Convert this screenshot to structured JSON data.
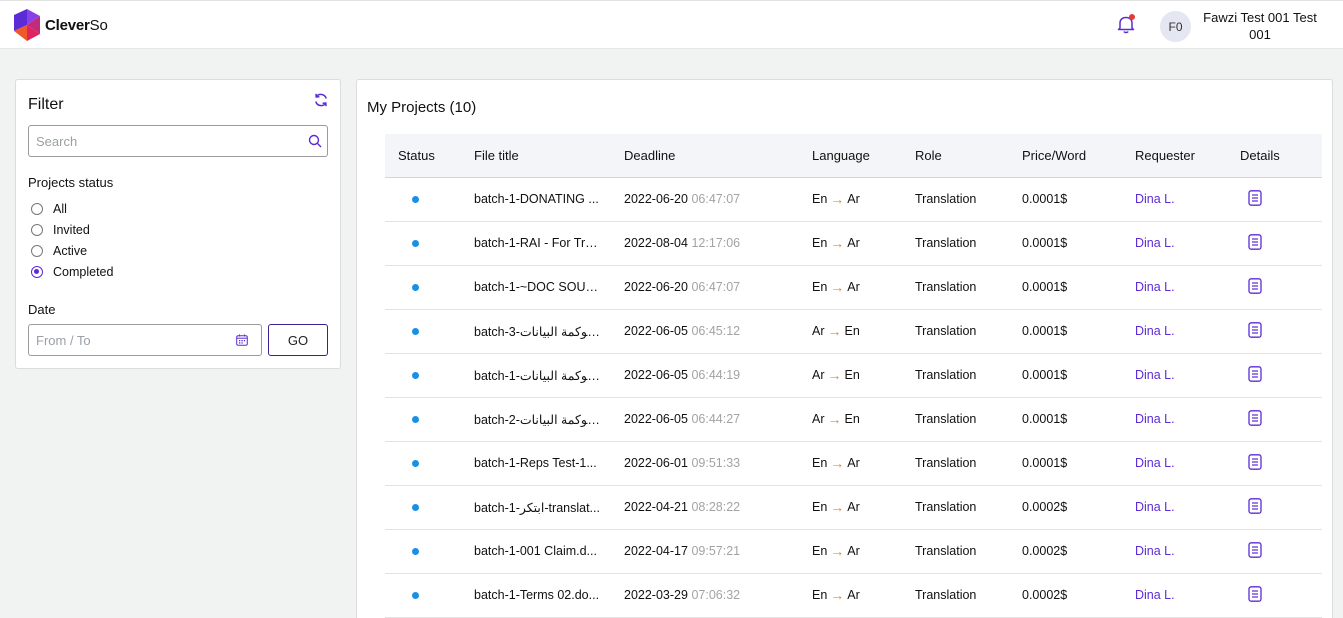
{
  "app": {
    "brand_bold": "Clever",
    "brand_rest": "So",
    "avatar_initials": "F0",
    "user_name": "Fawzi Test 001 Test 001",
    "logo_icon": "cleverso-logo-icon",
    "notification_icon": "bell-icon"
  },
  "colors": {
    "accent": "#5b2bd6",
    "status_dot": "#1a8fe3",
    "arrow": "#f08a24",
    "notification_dot": "#e53935"
  },
  "filter": {
    "title": "Filter",
    "search_placeholder": "Search",
    "status_label": "Projects status",
    "options": [
      "All",
      "Invited",
      "Active",
      "Completed"
    ],
    "selected": "Completed",
    "date_label": "Date",
    "date_placeholder": "From / To",
    "go_label": "GO"
  },
  "projects": {
    "title": "My Projects (10)",
    "columns": [
      "Status",
      "File title",
      "Deadline",
      "Language",
      "Role",
      "Price/Word",
      "Requester",
      "Details"
    ],
    "rows": [
      {
        "file": "batch-1-DONATING ...",
        "date": "2022-06-20",
        "time": "06:47:07",
        "src": "En",
        "tgt": "Ar",
        "role": "Translation",
        "price": "0.0001$",
        "requester": "Dina L."
      },
      {
        "file": "batch-1-RAI - For Tra...",
        "date": "2022-08-04",
        "time": "12:17:06",
        "src": "En",
        "tgt": "Ar",
        "role": "Translation",
        "price": "0.0001$",
        "requester": "Dina L."
      },
      {
        "file": "batch-1-~DOC SOUR...",
        "date": "2022-06-20",
        "time": "06:47:07",
        "src": "En",
        "tgt": "Ar",
        "role": "Translation",
        "price": "0.0001$",
        "requester": "Dina L."
      },
      {
        "file": "batch-3-لحوكمة البيانات ...",
        "date": "2022-06-05",
        "time": "06:45:12",
        "src": "Ar",
        "tgt": "En",
        "role": "Translation",
        "price": "0.0001$",
        "requester": "Dina L."
      },
      {
        "file": "batch-1-ة لحوكمة البيانات...",
        "date": "2022-06-05",
        "time": "06:44:19",
        "src": "Ar",
        "tgt": "En",
        "role": "Translation",
        "price": "0.0001$",
        "requester": "Dina L."
      },
      {
        "file": "batch-2-ة لحوكمة البيانات...",
        "date": "2022-06-05",
        "time": "06:44:27",
        "src": "Ar",
        "tgt": "En",
        "role": "Translation",
        "price": "0.0001$",
        "requester": "Dina L."
      },
      {
        "file": "batch-1-Reps Test-1...",
        "date": "2022-06-01",
        "time": "09:51:33",
        "src": "En",
        "tgt": "Ar",
        "role": "Translation",
        "price": "0.0001$",
        "requester": "Dina L."
      },
      {
        "file": "batch-1-ابتكر-translat...",
        "date": "2022-04-21",
        "time": "08:28:22",
        "src": "En",
        "tgt": "Ar",
        "role": "Translation",
        "price": "0.0002$",
        "requester": "Dina L."
      },
      {
        "file": "batch-1-001 Claim.d...",
        "date": "2022-04-17",
        "time": "09:57:21",
        "src": "En",
        "tgt": "Ar",
        "role": "Translation",
        "price": "0.0002$",
        "requester": "Dina L."
      },
      {
        "file": "batch-1-Terms 02.do...",
        "date": "2022-03-29",
        "time": "07:06:32",
        "src": "En",
        "tgt": "Ar",
        "role": "Translation",
        "price": "0.0002$",
        "requester": "Dina L."
      }
    ]
  }
}
